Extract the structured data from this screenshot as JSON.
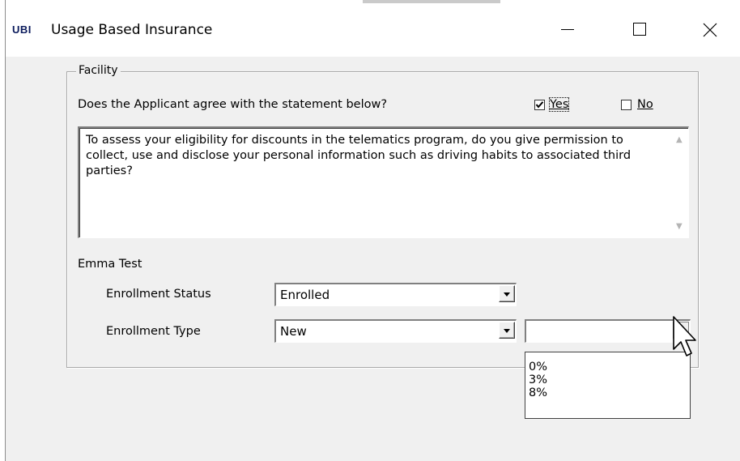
{
  "window": {
    "logo": "UBI",
    "title": "Usage Based Insurance"
  },
  "facility": {
    "group_label": "Facility",
    "question": "Does the Applicant agree with the statement below?",
    "yes_label": "Yes",
    "no_label": "No",
    "yes_checked": true,
    "no_checked": false,
    "statement": "To assess your eligibility for discounts in the telematics program, do you give permission to collect, use and disclose your personal information such as driving habits to associated third parties?"
  },
  "applicant": {
    "name": "Emma Test",
    "status_label": "Enrollment Status",
    "status_value": "Enrolled",
    "type_label": "Enrollment Type",
    "type_value": "New",
    "discount_value": "",
    "discount_options": [
      "0%",
      "3%",
      "8%"
    ]
  }
}
